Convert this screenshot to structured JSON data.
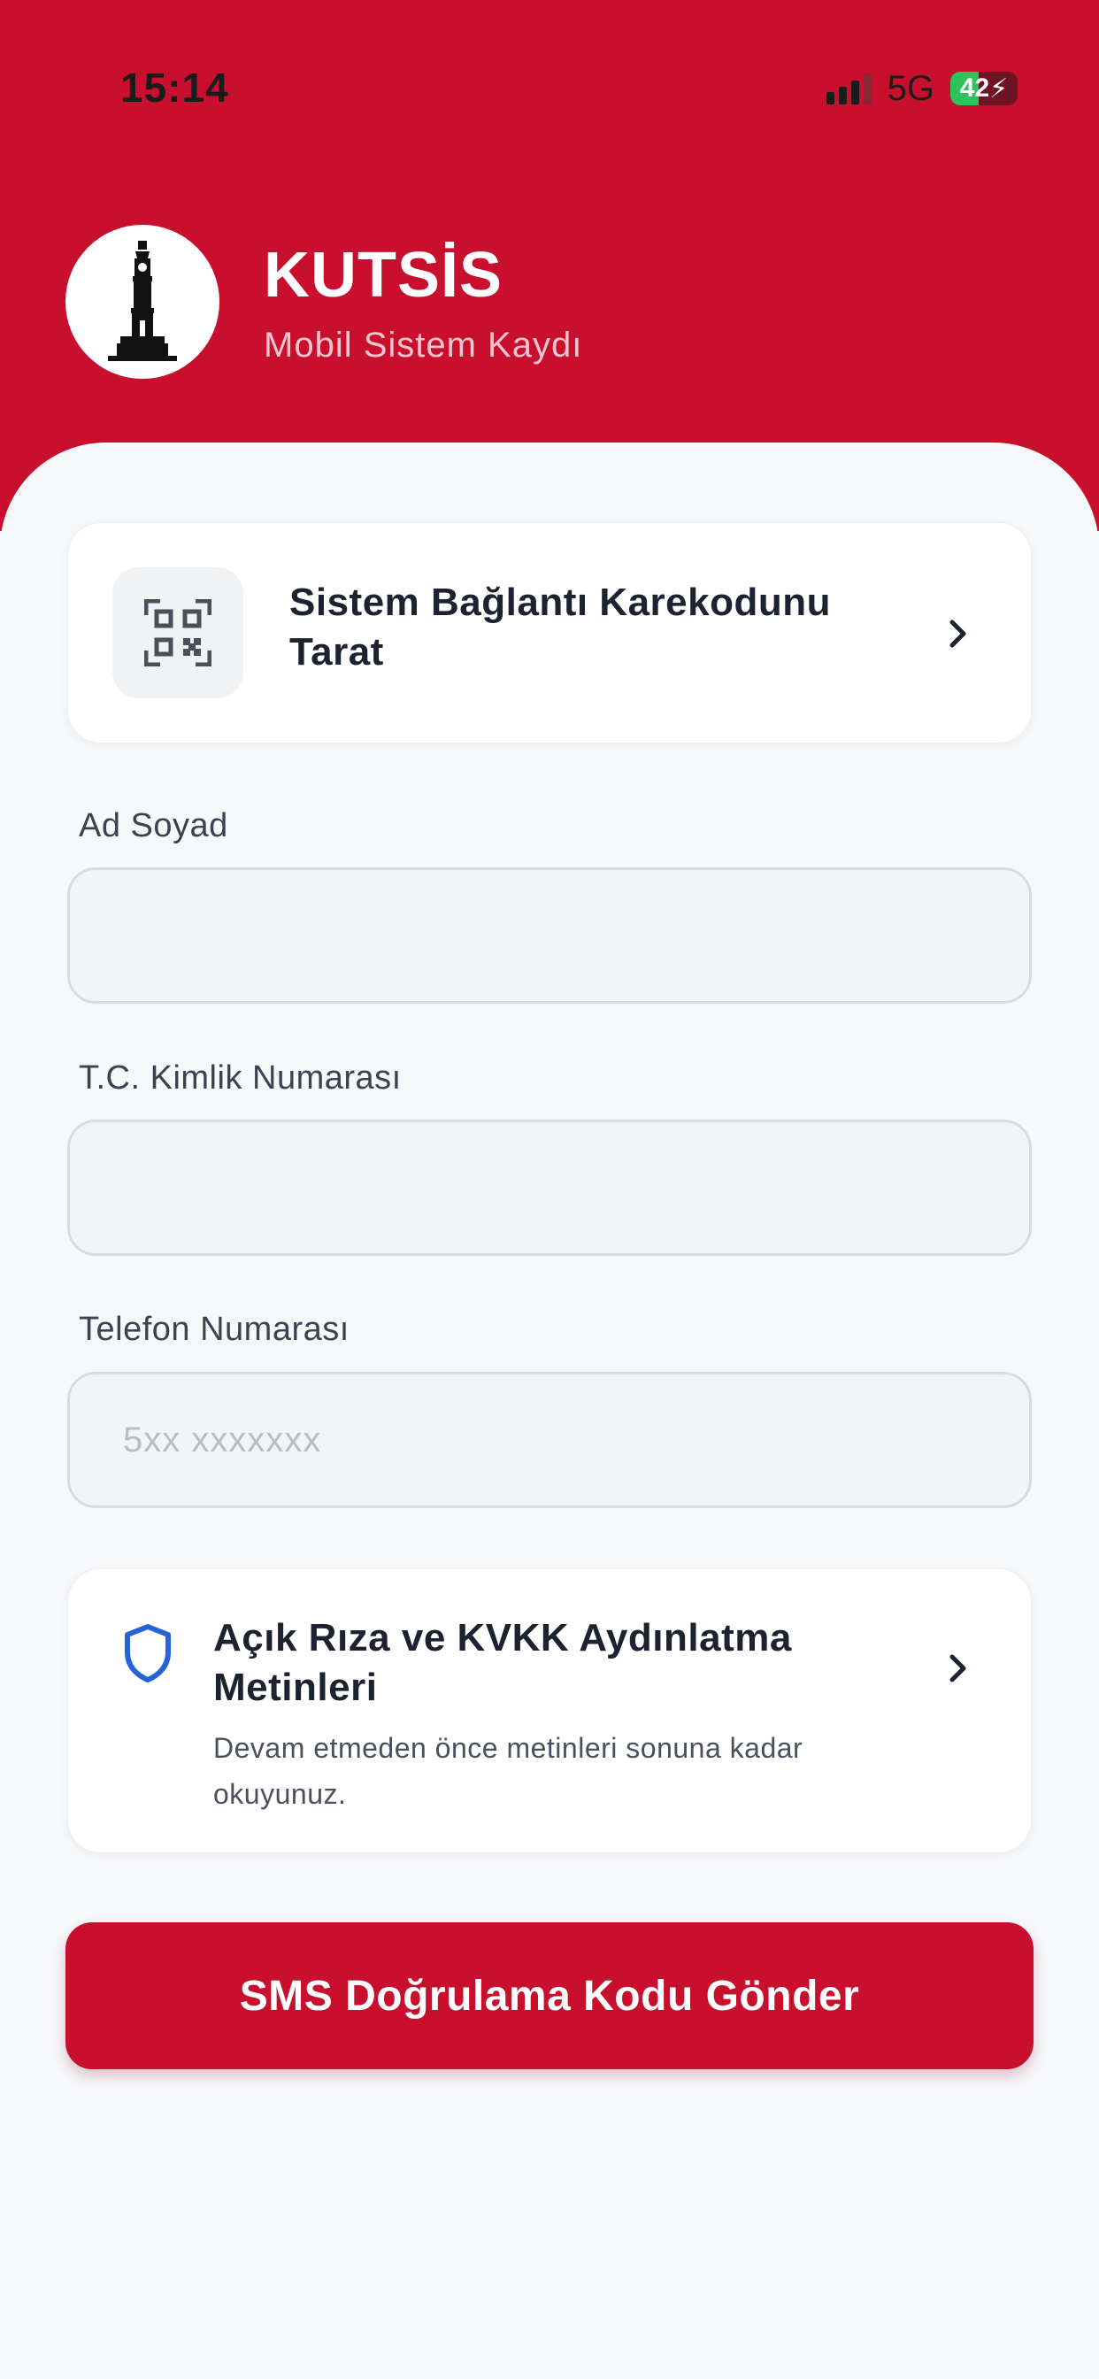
{
  "status_bar": {
    "time": "15:14",
    "network": "5G",
    "battery": "42",
    "battery_level_percent": 42
  },
  "header": {
    "app_title": "KUTSİS",
    "app_subtitle": "Mobil Sistem Kaydı",
    "logo_icon": "clock-tower-icon"
  },
  "qr_card": {
    "label": "Sistem Bağlantı Karekodunu Tarat",
    "icon": "qr-code-icon"
  },
  "form": {
    "name": {
      "label": "Ad Soyad",
      "value": "",
      "placeholder": ""
    },
    "tc": {
      "label": "T.C. Kimlik Numarası",
      "value": "",
      "placeholder": ""
    },
    "phone": {
      "label": "Telefon Numarası",
      "value": "",
      "placeholder": "5xx xxxxxxx"
    }
  },
  "kvkk_card": {
    "title": "Açık Rıza ve KVKK Aydınlatma Metinleri",
    "description": "Devam etmeden önce metinleri sonuna kadar okuyunuz.",
    "icon": "shield-icon"
  },
  "submit_button": {
    "label": "SMS Doğrulama Kodu Gönder"
  },
  "colors": {
    "brand": "#c8102e",
    "background": "#f7f8fa",
    "shield": "#2463d9"
  }
}
